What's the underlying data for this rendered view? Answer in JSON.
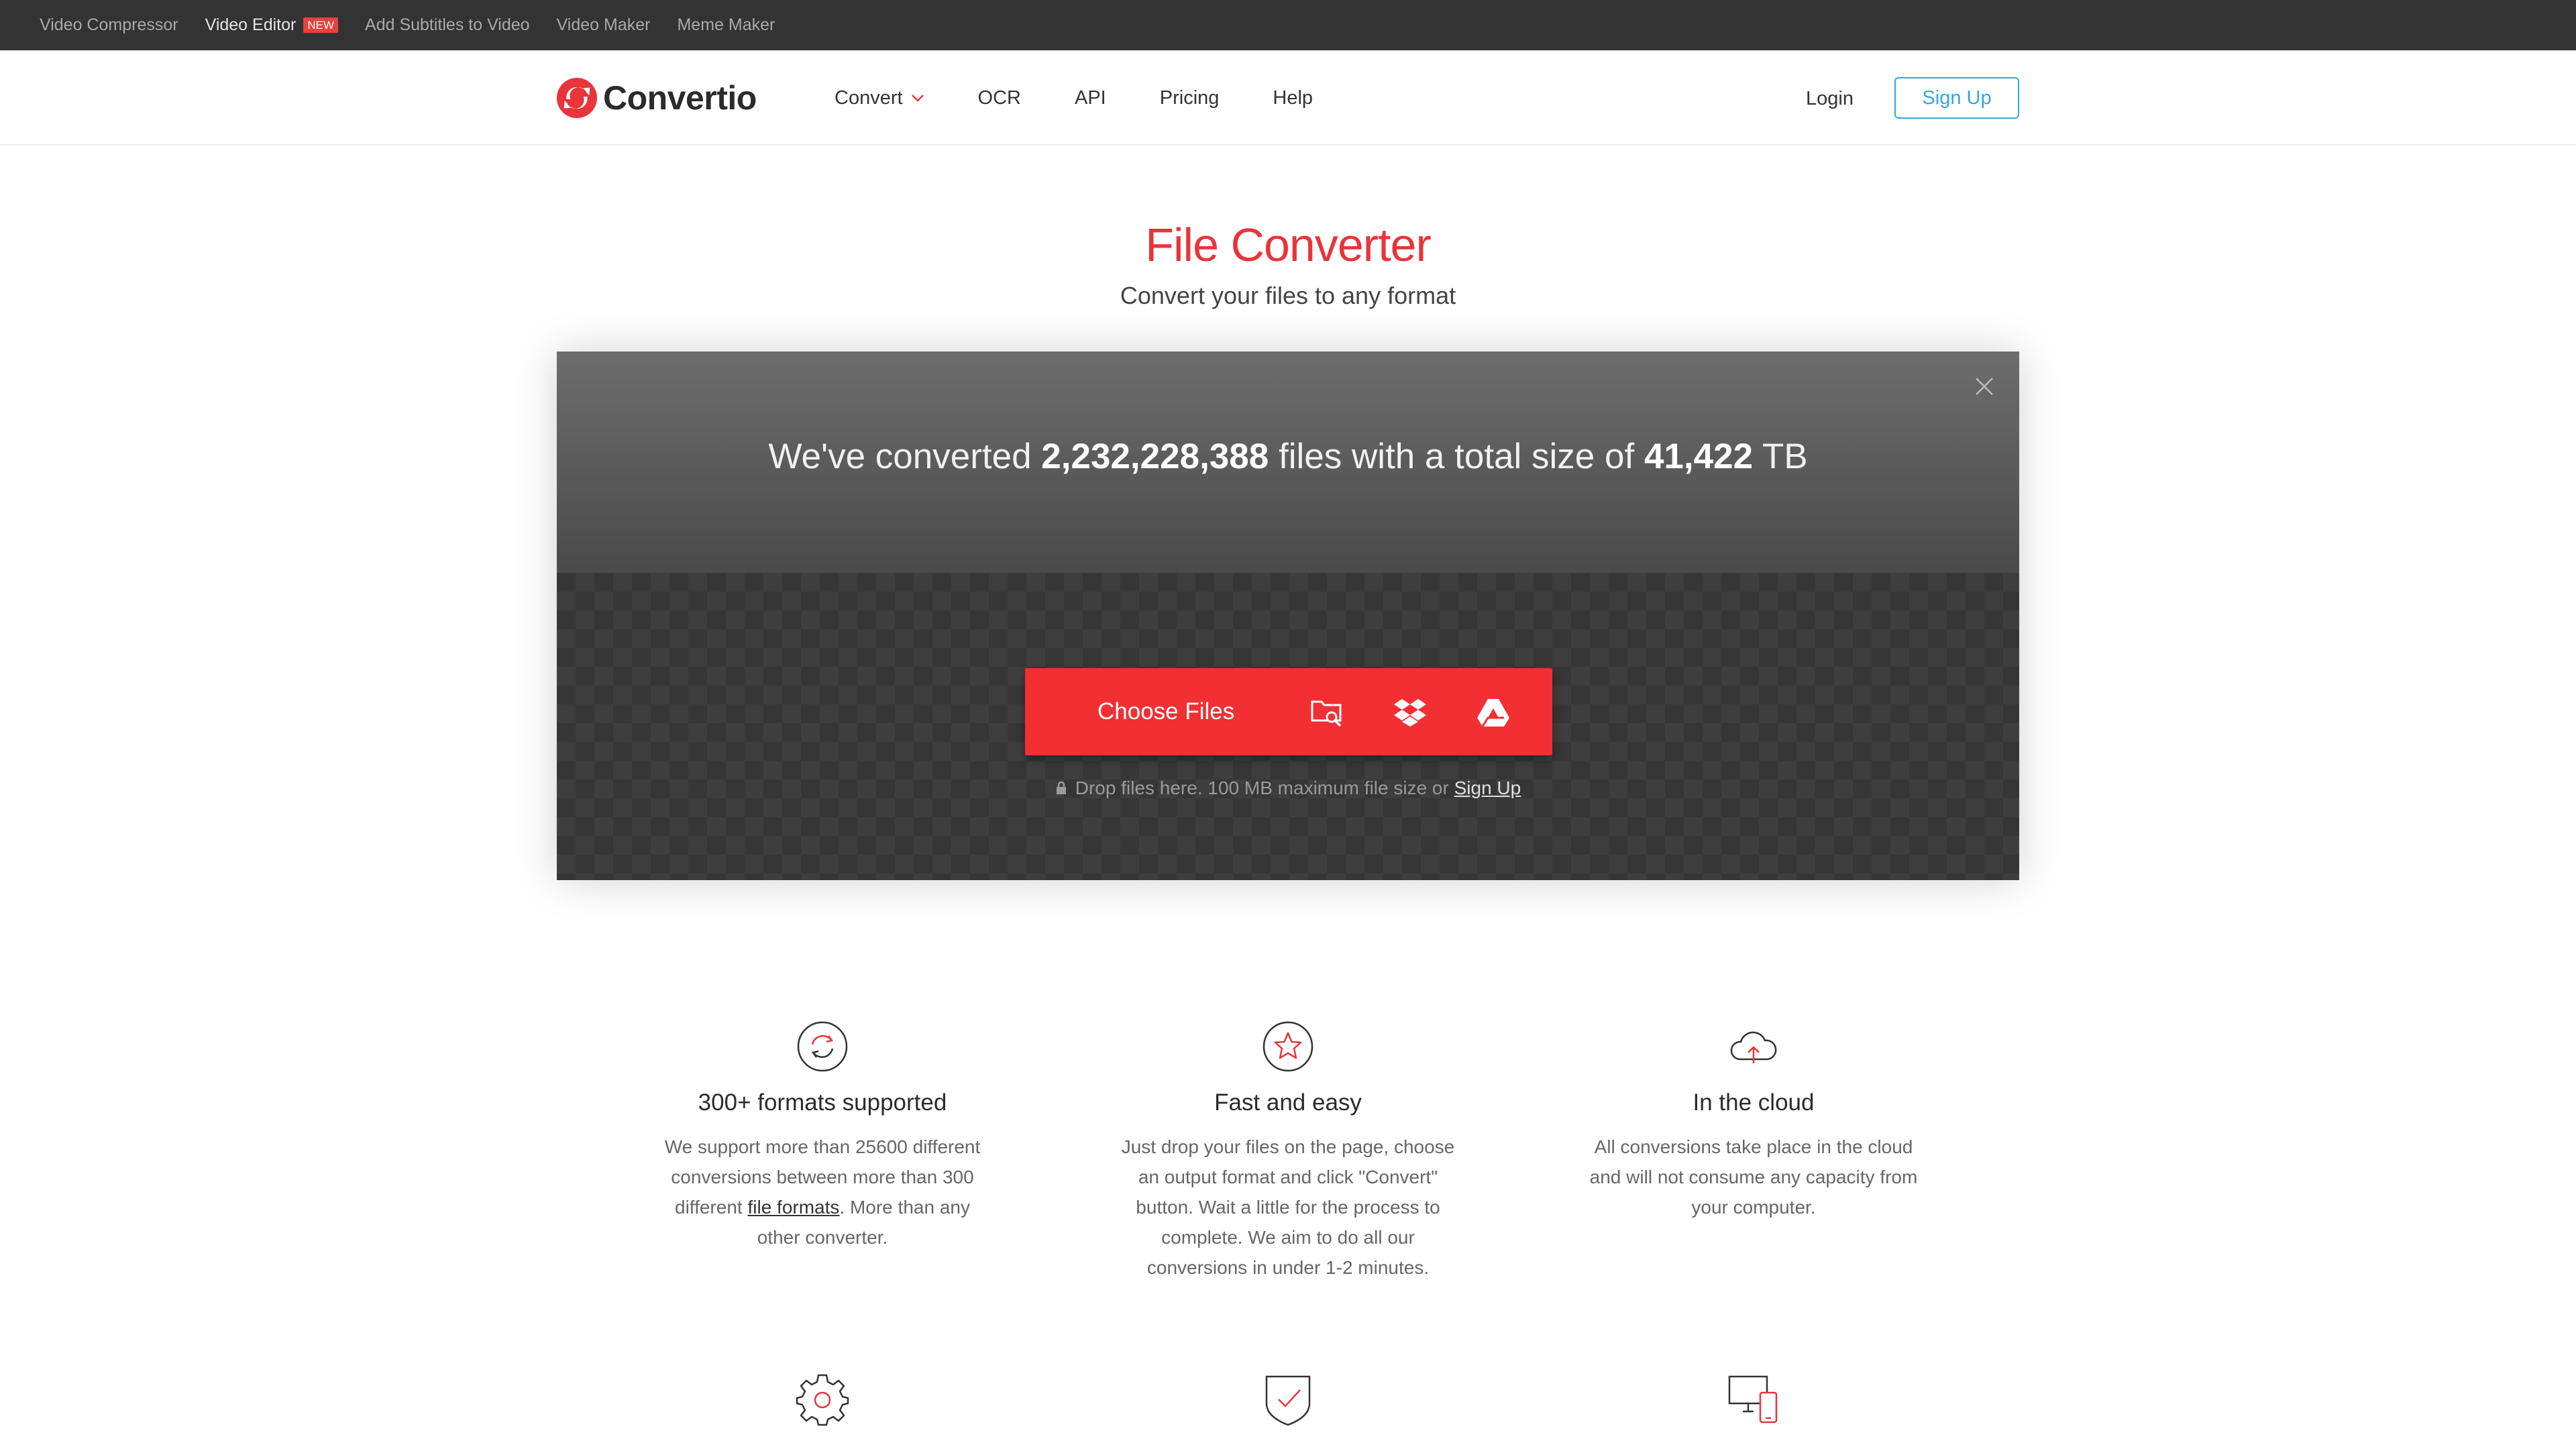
{
  "topbar": {
    "items": [
      {
        "label": "Video Compressor"
      },
      {
        "label": "Video Editor",
        "badge": "NEW"
      },
      {
        "label": "Add Subtitles to Video"
      },
      {
        "label": "Video Maker"
      },
      {
        "label": "Meme Maker"
      }
    ]
  },
  "header": {
    "logo_text": "Convertio",
    "nav": [
      {
        "label": "Convert"
      },
      {
        "label": "OCR"
      },
      {
        "label": "API"
      },
      {
        "label": "Pricing"
      },
      {
        "label": "Help"
      }
    ],
    "login": "Login",
    "signup": "Sign Up"
  },
  "hero": {
    "title": "File Converter",
    "subtitle": "Convert your files to any format"
  },
  "stats": {
    "prefix": "We've converted",
    "files_count": "2,232,228,388",
    "middle": "files with a total size of",
    "total_size": "41,422",
    "unit": "TB"
  },
  "upload": {
    "choose_label": "Choose Files",
    "sources": [
      "folder-search-icon",
      "dropbox-icon",
      "google-drive-icon"
    ],
    "hint_text": "Drop files here. 100 MB maximum file size or",
    "hint_link": "Sign Up"
  },
  "features": [
    {
      "icon": "refresh-icon",
      "title": "300+ formats supported",
      "desc_before": "We support more than 25600 different conversions between more than 300 different",
      "desc_link": "file formats",
      "desc_after": ". More than any other converter."
    },
    {
      "icon": "star-icon",
      "title": "Fast and easy",
      "desc": "Just drop your files on the page, choose an output format and click \"Convert\" button. Wait a little for the process to complete. We aim to do all our conversions in under 1-2 minutes."
    },
    {
      "icon": "cloud-upload-icon",
      "title": "In the cloud",
      "desc": "All conversions take place in the cloud and will not consume any capacity from your computer."
    }
  ],
  "bottom_icons": [
    "gear-icon",
    "shield-check-icon",
    "devices-icon"
  ],
  "colors": {
    "brand_red": "#e8343a",
    "button_red": "#f22f33",
    "signup_blue": "#31a9d9",
    "topbar_bg": "#333333"
  }
}
